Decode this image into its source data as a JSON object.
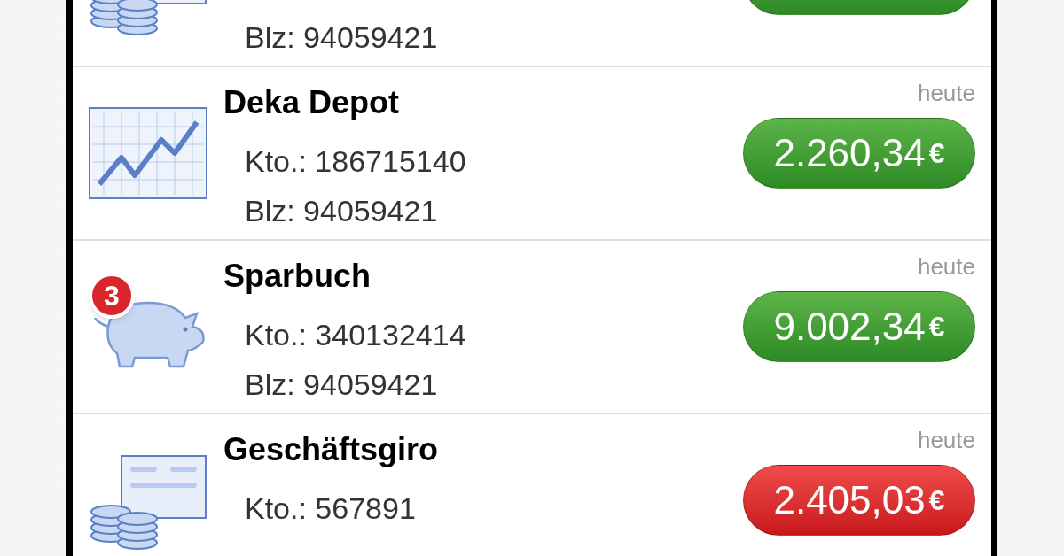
{
  "accounts": [
    {
      "kind": "coins-card",
      "blz": "Blz: 94059421",
      "negative": false
    },
    {
      "kind": "chart",
      "name": "Deka Depot",
      "kto": "Kto.: 186715140",
      "blz": "Blz: 94059421",
      "date": "heute",
      "amount": "2.260,34",
      "currency": "€",
      "negative": false
    },
    {
      "kind": "piggy",
      "badge": "3",
      "name": "Sparbuch",
      "kto": "Kto.: 340132414",
      "blz": "Blz: 94059421",
      "date": "heute",
      "amount": "9.002,34",
      "currency": "€",
      "negative": false
    },
    {
      "kind": "card-coins",
      "name": "Geschäftsgiro",
      "kto": "Kto.: 567891",
      "date": "heute",
      "amount": "2.405,03",
      "currency": "€",
      "negative": true
    }
  ]
}
